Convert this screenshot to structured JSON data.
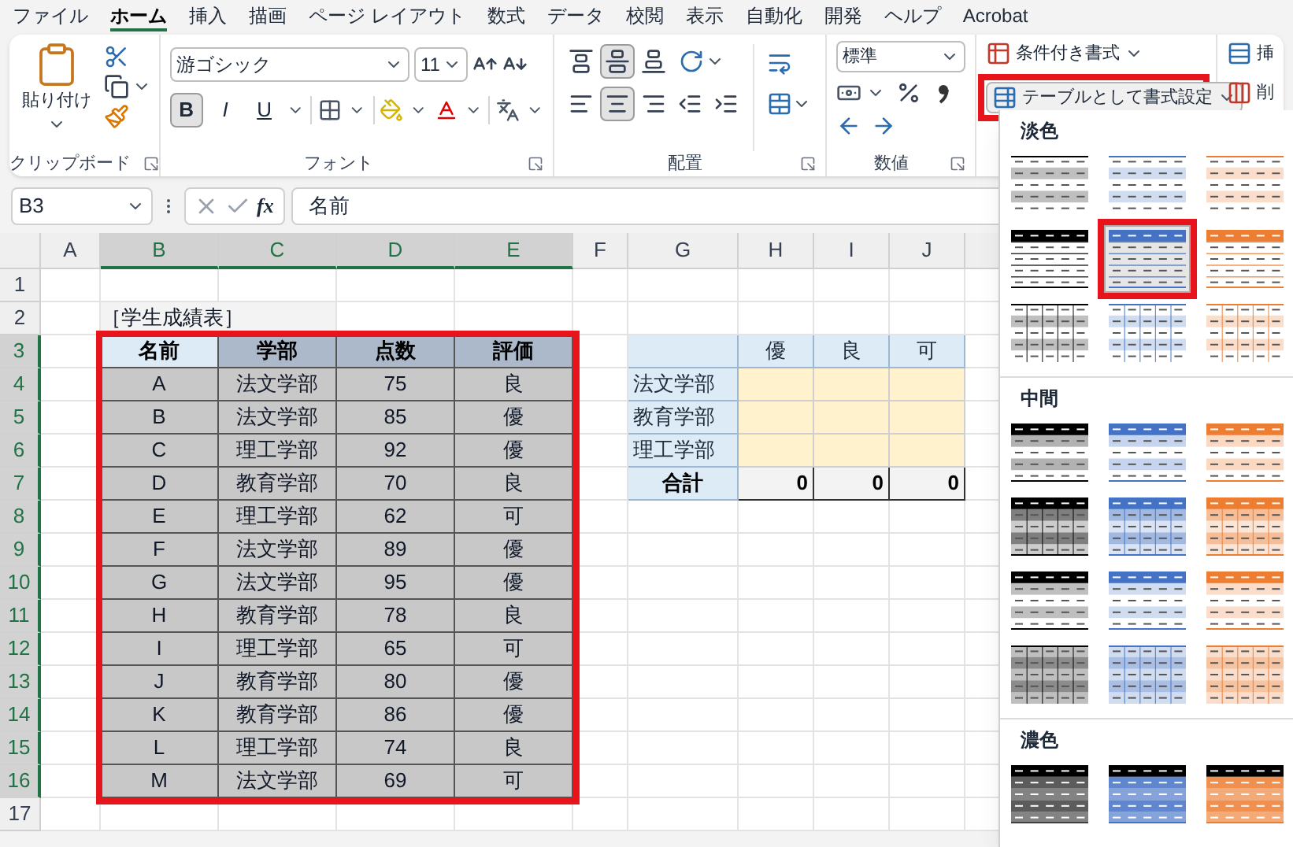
{
  "menu_tabs": [
    {
      "label": "ファイル",
      "selected": false
    },
    {
      "label": "ホーム",
      "selected": true
    },
    {
      "label": "挿入",
      "selected": false
    },
    {
      "label": "描画",
      "selected": false
    },
    {
      "label": "ページ レイアウト",
      "selected": false
    },
    {
      "label": "数式",
      "selected": false
    },
    {
      "label": "データ",
      "selected": false
    },
    {
      "label": "校閲",
      "selected": false
    },
    {
      "label": "表示",
      "selected": false
    },
    {
      "label": "自動化",
      "selected": false
    },
    {
      "label": "開発",
      "selected": false
    },
    {
      "label": "ヘルプ",
      "selected": false
    },
    {
      "label": "Acrobat",
      "selected": false
    }
  ],
  "ribbon": {
    "clipboard": {
      "paste_label": "貼り付け",
      "group_label": "クリップボード"
    },
    "font": {
      "font_name": "游ゴシック",
      "font_size": "11",
      "style_buttons": [
        {
          "label": "B",
          "selected": true
        },
        {
          "label": "I",
          "selected": false
        },
        {
          "label": "U",
          "selected": false
        }
      ],
      "group_label": "フォント"
    },
    "alignment": {
      "top_row": [
        {
          "kind": "top",
          "selected": false
        },
        {
          "kind": "middle",
          "selected": true
        },
        {
          "kind": "bottom",
          "selected": false
        }
      ],
      "bottom_row": [
        {
          "kind": "left",
          "selected": false
        },
        {
          "kind": "center",
          "selected": true
        },
        {
          "kind": "right",
          "selected": false
        },
        {
          "kind": "outdent",
          "selected": false
        },
        {
          "kind": "indent",
          "selected": false
        }
      ],
      "group_label": "配置"
    },
    "number": {
      "format": "標準",
      "group_label": "数値"
    },
    "styles": {
      "conditional_label": "条件付き書式",
      "table_format_label": "テーブルとして書式設定",
      "table_format_highlighted": true
    },
    "cells": {
      "insert_label": "挿",
      "delete_label": "削"
    }
  },
  "formula_bar": {
    "name_box": "B3",
    "function_label": "fx",
    "formula": "名前"
  },
  "sheet": {
    "columns": [
      {
        "letter": "A",
        "selected": false
      },
      {
        "letter": "B",
        "selected": true
      },
      {
        "letter": "C",
        "selected": true
      },
      {
        "letter": "D",
        "selected": true
      },
      {
        "letter": "E",
        "selected": true
      },
      {
        "letter": "F",
        "selected": false
      },
      {
        "letter": "G",
        "selected": false
      },
      {
        "letter": "H",
        "selected": false
      },
      {
        "letter": "I",
        "selected": false
      },
      {
        "letter": "J",
        "selected": false
      }
    ],
    "rows": [
      {
        "number": "1",
        "selected": false
      },
      {
        "number": "2",
        "selected": false
      },
      {
        "number": "3",
        "selected": true
      },
      {
        "number": "4",
        "selected": true
      },
      {
        "number": "5",
        "selected": true
      },
      {
        "number": "6",
        "selected": true
      },
      {
        "number": "7",
        "selected": true
      },
      {
        "number": "8",
        "selected": true
      },
      {
        "number": "9",
        "selected": true
      },
      {
        "number": "10",
        "selected": true
      },
      {
        "number": "11",
        "selected": true
      },
      {
        "number": "12",
        "selected": true
      },
      {
        "number": "13",
        "selected": true
      },
      {
        "number": "14",
        "selected": true
      },
      {
        "number": "15",
        "selected": true
      },
      {
        "number": "16",
        "selected": true
      },
      {
        "number": "17",
        "selected": false
      }
    ],
    "title": "［学生成績表］",
    "main_table": {
      "highlighted": true,
      "columns": [
        {
          "label": "名前",
          "selected": true
        },
        {
          "label": "学部",
          "selected": false
        },
        {
          "label": "点数",
          "selected": false
        },
        {
          "label": "評価",
          "selected": false
        }
      ],
      "rows": [
        [
          "A",
          "法文学部",
          "75",
          "良"
        ],
        [
          "B",
          "法文学部",
          "85",
          "優"
        ],
        [
          "C",
          "理工学部",
          "92",
          "優"
        ],
        [
          "D",
          "教育学部",
          "70",
          "良"
        ],
        [
          "E",
          "理工学部",
          "62",
          "可"
        ],
        [
          "F",
          "法文学部",
          "89",
          "優"
        ],
        [
          "G",
          "法文学部",
          "95",
          "優"
        ],
        [
          "H",
          "教育学部",
          "78",
          "良"
        ],
        [
          "I",
          "理工学部",
          "65",
          "可"
        ],
        [
          "J",
          "教育学部",
          "80",
          "優"
        ],
        [
          "K",
          "教育学部",
          "86",
          "優"
        ],
        [
          "L",
          "理工学部",
          "74",
          "良"
        ],
        [
          "M",
          "法文学部",
          "69",
          "可"
        ]
      ]
    },
    "summary_table": {
      "columns": [
        "優",
        "良",
        "可"
      ],
      "rows": [
        "法文学部",
        "教育学部",
        "理工学部"
      ],
      "total_label": "合計",
      "totals": [
        "0",
        "0",
        "0"
      ]
    }
  },
  "gallery": {
    "sections": [
      {
        "title": "淡色",
        "styles": [
          {
            "kind": "light_banded",
            "color": "#000000",
            "selected": false
          },
          {
            "kind": "light_banded",
            "color": "#4472c4",
            "selected": false
          },
          {
            "kind": "light_banded",
            "color": "#ed7d31",
            "selected": false
          },
          {
            "kind": "light_header",
            "color": "#000000",
            "selected": false
          },
          {
            "kind": "light_header",
            "color": "#4472c4",
            "selected": true
          },
          {
            "kind": "light_header",
            "color": "#ed7d31",
            "selected": false
          },
          {
            "kind": "light_grid",
            "color": "#000000",
            "selected": false
          },
          {
            "kind": "light_grid",
            "color": "#4472c4",
            "selected": false
          },
          {
            "kind": "light_grid",
            "color": "#ed7d31",
            "selected": false
          }
        ]
      },
      {
        "title": "中間",
        "styles": [
          {
            "kind": "medium_header",
            "color": "#000000",
            "selected": false
          },
          {
            "kind": "medium_header",
            "color": "#4472c4",
            "selected": false
          },
          {
            "kind": "medium_header",
            "color": "#ed7d31",
            "selected": false
          },
          {
            "kind": "medium_banded",
            "color": "#000000",
            "selected": false
          },
          {
            "kind": "medium_banded",
            "color": "#4472c4",
            "selected": false
          },
          {
            "kind": "medium_banded",
            "color": "#ed7d31",
            "selected": false
          },
          {
            "kind": "medium_line",
            "color": "#000000",
            "selected": false
          },
          {
            "kind": "medium_line",
            "color": "#4472c4",
            "selected": false
          },
          {
            "kind": "medium_line",
            "color": "#ed7d31",
            "selected": false
          },
          {
            "kind": "medium_grid",
            "color": "#000000",
            "selected": false
          },
          {
            "kind": "medium_grid",
            "color": "#4472c4",
            "selected": false
          },
          {
            "kind": "medium_grid",
            "color": "#ed7d31",
            "selected": false
          }
        ]
      },
      {
        "title": "濃色",
        "styles": [
          {
            "kind": "dark",
            "color": "#404040",
            "selected": false
          },
          {
            "kind": "dark",
            "color": "#4472c4",
            "selected": false
          },
          {
            "kind": "dark",
            "color": "#ed7d31",
            "selected": false
          }
        ]
      }
    ]
  }
}
